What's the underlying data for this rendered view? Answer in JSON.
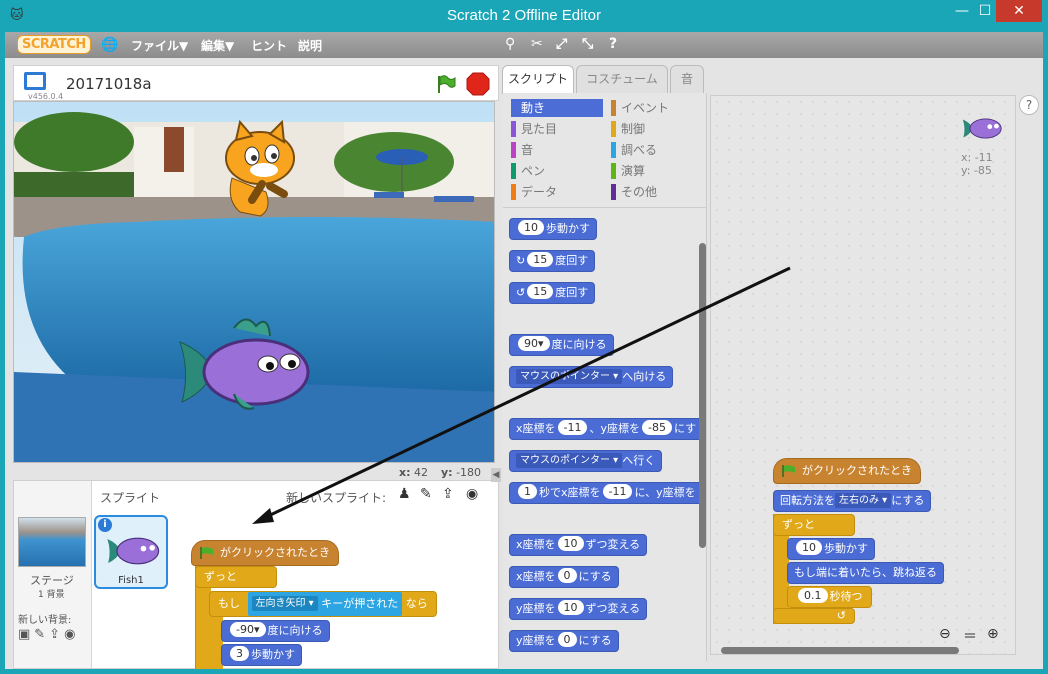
{
  "window": {
    "title": "Scratch 2 Offline Editor",
    "min": "—",
    "max": "☐",
    "close": "✕"
  },
  "menubar": {
    "logo": "SCRATCH",
    "file": "ファイル▼",
    "edit": "編集▼",
    "tips": "ヒント",
    "about": "説明"
  },
  "stage_header": {
    "project_name": "20171018a",
    "version": "v456.0.4"
  },
  "stage_coords": {
    "x_label": "x:",
    "x_val": "42",
    "y_label": "y:",
    "y_val": "-180"
  },
  "sprite_panel": {
    "title": "スプライト",
    "new_sprite": "新しいスプライト:",
    "stage_label": "ステージ",
    "stage_count": "1 背景",
    "new_backdrop": "新しい背景:",
    "fish_name": "Fish1"
  },
  "tabs": [
    "スクリプト",
    "コスチューム",
    "音"
  ],
  "categories": {
    "left": [
      {
        "label": "動き",
        "color": "#4a6cd4"
      },
      {
        "label": "見た目",
        "color": "#8a55d7"
      },
      {
        "label": "音",
        "color": "#bb42c3"
      },
      {
        "label": "ペン",
        "color": "#0e9a6c"
      },
      {
        "label": "データ",
        "color": "#ee7d16"
      }
    ],
    "right": [
      {
        "label": "イベント",
        "color": "#c88330"
      },
      {
        "label": "制御",
        "color": "#e1a91a"
      },
      {
        "label": "調べる",
        "color": "#2ca5e2"
      },
      {
        "label": "演算",
        "color": "#5cb712"
      },
      {
        "label": "その他",
        "color": "#632d99"
      }
    ]
  },
  "palette_blocks": {
    "move_val": "10",
    "move": "歩動かす",
    "turn_r_val": "15",
    "turn_r": "度回す",
    "turn_l_val": "15",
    "turn_l": "度回す",
    "point_val": "90▾",
    "point": "度に向ける",
    "point_to_drop": "マウスのポインター ▾",
    "point_to": "へ向ける",
    "goto_xy_a": "x座標を",
    "goto_xy_x": "-11",
    "goto_xy_b": "、y座標を",
    "goto_xy_y": "-85",
    "goto_xy_c": "にす",
    "goto_drop": "マウスのポインター ▾",
    "goto": "へ行く",
    "glide_val": "1",
    "glide_a": "秒でx座標を",
    "glide_x": "-11",
    "glide_b": "に、y座標を",
    "change_x_a": "x座標を",
    "change_x_val": "10",
    "change_x_b": "ずつ変える",
    "set_x_a": "x座標を",
    "set_x_val": "0",
    "set_x_b": "にする",
    "change_y_a": "y座標を",
    "change_y_val": "10",
    "change_y_b": "ずつ変える",
    "set_y_a": "y座標を",
    "set_y_val": "0",
    "set_y_b": "にする"
  },
  "script_area": {
    "sprite_x": "x: -11",
    "sprite_y": "y: -85",
    "hat": "がクリックされたとき",
    "rot_a": "回転方法を",
    "rot_drop": "左右のみ ▾",
    "rot_b": "にする",
    "forever": "ずっと",
    "move_val": "10",
    "move": "歩動かす",
    "bounce": "もし端に着いたら、跳ね返る",
    "wait_val": "0.1",
    "wait": "秒待つ",
    "loop_arrow": "↺"
  },
  "drag_script": {
    "hat": "がクリックされたとき",
    "forever": "ずっと",
    "if": "もし",
    "key_drop": "左向き矢印 ▾",
    "key_pressed": "キーが押された",
    "then": "なら",
    "point_val": "-90▾",
    "point": "度に向ける",
    "move_val": "3",
    "move": "歩動かす"
  }
}
